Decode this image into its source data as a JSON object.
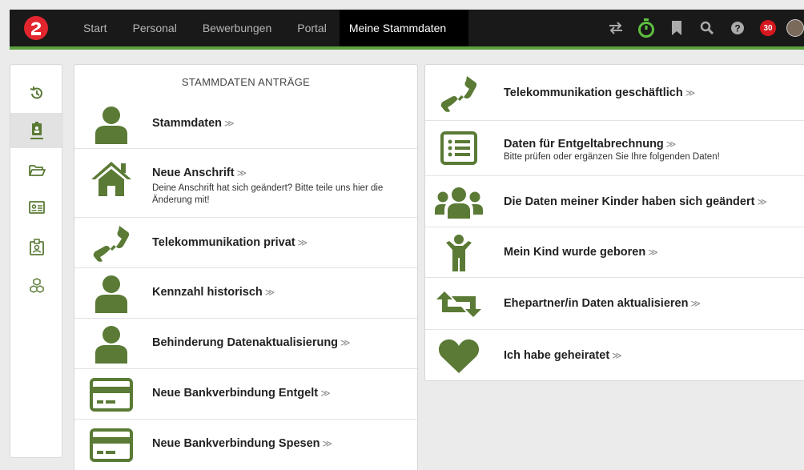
{
  "colors": {
    "accent": "#5a7a35",
    "nav_bg": "#191919",
    "green_bar": "#5aa03c",
    "badge": "#d4181e",
    "timer": "#5ec040"
  },
  "nav": {
    "links": [
      "Start",
      "Personal",
      "Bewerbungen",
      "Portal",
      "Meine Stammdaten"
    ],
    "active": "Meine Stammdaten",
    "badge_count": "30",
    "icons": [
      "swap-icon",
      "stopwatch-icon",
      "bookmark-icon",
      "search-icon",
      "help-icon"
    ]
  },
  "sidebar": {
    "icons": [
      "history-icon",
      "badge-icon",
      "folder-icon",
      "id-card-icon",
      "id-badge-icon",
      "cubes-icon"
    ],
    "active_index": 1
  },
  "left_panel": {
    "title": "STAMMDATEN ANTRÄGE",
    "items": [
      {
        "title": "Stammdaten",
        "desc": "",
        "icon": "person-icon"
      },
      {
        "title": "Neue Anschrift",
        "desc": "Deine Anschrift hat sich geändert? Bitte teile uns hier die Änderung mit!",
        "icon": "house-icon"
      },
      {
        "title": "Telekommunikation privat",
        "desc": "",
        "icon": "phone-icon"
      },
      {
        "title": "Kennzahl historisch",
        "desc": "",
        "icon": "person-icon"
      },
      {
        "title": "Behinderung Datenaktualisierung",
        "desc": "",
        "icon": "person-icon"
      },
      {
        "title": "Neue Bankverbindung Entgelt",
        "desc": "",
        "icon": "credit-card-icon"
      },
      {
        "title": "Neue Bankverbindung Spesen",
        "desc": "",
        "icon": "credit-card-icon"
      }
    ]
  },
  "right_panel": {
    "items": [
      {
        "title": "Telekommunikation geschäftlich",
        "desc": "",
        "icon": "phone-icon"
      },
      {
        "title": "Daten für Entgeltabrechnung",
        "desc": "Bitte prüfen oder ergänzen Sie Ihre folgenden Daten!",
        "icon": "list-icon"
      },
      {
        "title": "Die Daten meiner Kinder haben sich geändert",
        "desc": "",
        "icon": "group-icon"
      },
      {
        "title": "Mein Kind wurde geboren",
        "desc": "",
        "icon": "child-icon"
      },
      {
        "title": "Ehepartner/in Daten aktualisieren",
        "desc": "",
        "icon": "retweet-icon"
      },
      {
        "title": "Ich habe geheiratet",
        "desc": "",
        "icon": "heart-icon"
      }
    ]
  },
  "chevron": "≫"
}
